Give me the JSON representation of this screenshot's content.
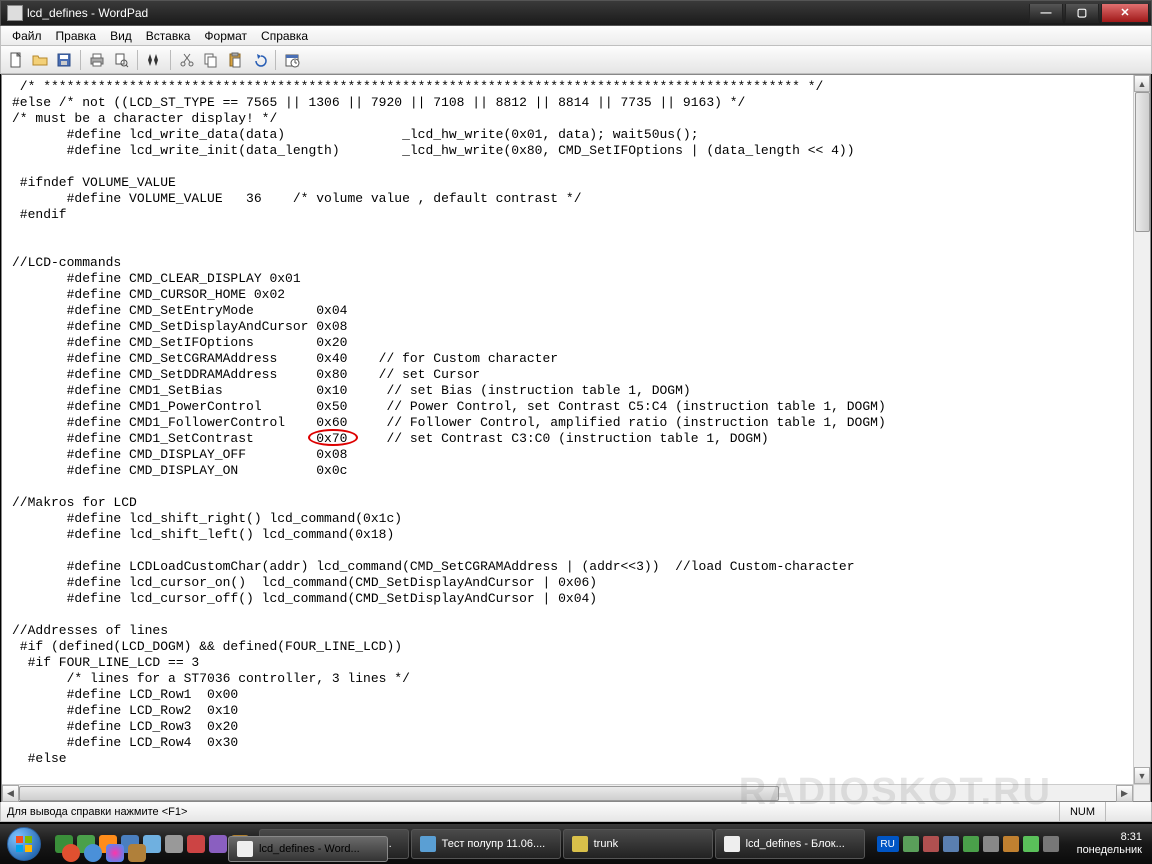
{
  "window": {
    "title": "lcd_defines - WordPad"
  },
  "menu": [
    "Файл",
    "Правка",
    "Вид",
    "Вставка",
    "Формат",
    "Справка"
  ],
  "statusbar": {
    "help": "Для вывода справки нажмите <F1>",
    "num": "NUM"
  },
  "taskbar": {
    "tasks": [
      {
        "label": "Новая вкладка - S...",
        "active": false
      },
      {
        "label": "Тест полупр 11.06....",
        "active": false
      },
      {
        "label": "trunk",
        "active": false
      },
      {
        "label": "lcd_defines - Блок...",
        "active": false
      },
      {
        "label": "lcd_defines - Word...",
        "active": true
      }
    ],
    "lang": "RU",
    "time": "8:31",
    "day": "понедельник"
  },
  "code_lines": [
    " /* ************************************************************************************************* */",
    "#else /* not ((LCD_ST_TYPE == 7565 || 1306 || 7920 || 7108 || 8812 || 8814 || 7735 || 9163) */",
    "/* must be a character display! */",
    "       #define lcd_write_data(data)               _lcd_hw_write(0x01, data); wait50us();",
    "       #define lcd_write_init(data_length)        _lcd_hw_write(0x80, CMD_SetIFOptions | (data_length << 4))",
    "",
    " #ifndef VOLUME_VALUE",
    "       #define VOLUME_VALUE   36    /* volume value , default contrast */",
    " #endif",
    "",
    "",
    "//LCD-commands",
    "       #define CMD_CLEAR_DISPLAY 0x01",
    "       #define CMD_CURSOR_HOME 0x02",
    "       #define CMD_SetEntryMode        0x04",
    "       #define CMD_SetDisplayAndCursor 0x08",
    "       #define CMD_SetIFOptions        0x20",
    "       #define CMD_SetCGRAMAddress     0x40    // for Custom character",
    "       #define CMD_SetDDRAMAddress     0x80    // set Cursor",
    "       #define CMD1_SetBias            0x10     // set Bias (instruction table 1, DOGM)",
    "       #define CMD1_PowerControl       0x50     // Power Control, set Contrast C5:C4 (instruction table 1, DOGM)",
    "       #define CMD1_FollowerControl    0x60     // Follower Control, amplified ratio (instruction table 1, DOGM)",
    "       #define CMD1_SetContrast        0x70     // set Contrast C3:C0 (instruction table 1, DOGM)",
    "       #define CMD_DISPLAY_OFF         0x08",
    "       #define CMD_DISPLAY_ON          0x0c",
    "",
    "//Makros for LCD",
    "       #define lcd_shift_right() lcd_command(0x1c)",
    "       #define lcd_shift_left() lcd_command(0x18)",
    "",
    "       #define LCDLoadCustomChar(addr) lcd_command(CMD_SetCGRAMAddress | (addr<<3))  //load Custom-character",
    "       #define lcd_cursor_on()  lcd_command(CMD_SetDisplayAndCursor | 0x06)",
    "       #define lcd_cursor_off() lcd_command(CMD_SetDisplayAndCursor | 0x04)",
    "",
    "//Addresses of lines",
    " #if (defined(LCD_DOGM) && defined(FOUR_LINE_LCD))",
    "  #if FOUR_LINE_LCD == 3",
    "       /* lines for a ST7036 controller, 3 lines */",
    "       #define LCD_Row1  0x00",
    "       #define LCD_Row2  0x10",
    "       #define LCD_Row3  0x20",
    "       #define LCD_Row4  0x30",
    "  #else"
  ],
  "annotation": {
    "ring_line_index": 22
  }
}
